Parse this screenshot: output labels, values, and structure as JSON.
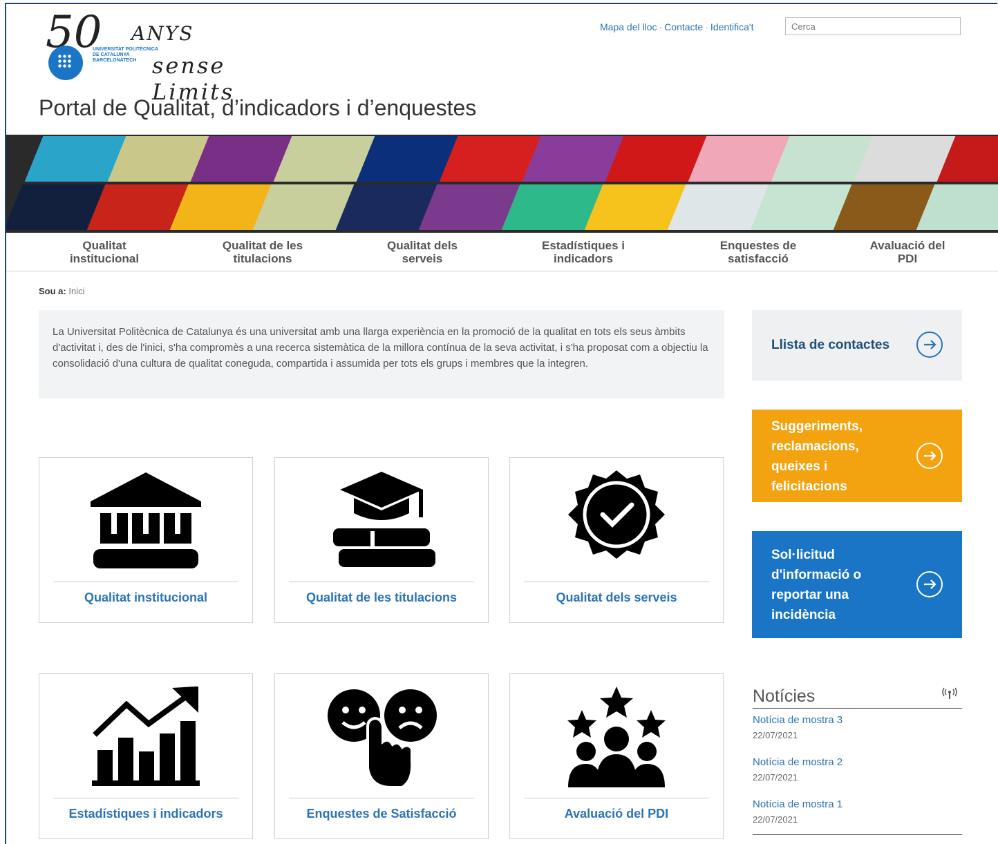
{
  "header": {
    "logo_fifty": "50",
    "logo_anys": "ANYS",
    "logo_university": [
      "UNIVERSITAT POLITÈCNICA",
      "DE CATALUNYA",
      "BARCELONATECH"
    ],
    "logo_slogan": "sense Limits",
    "links": [
      "Mapa del lloc",
      "Contacte",
      "Identifica't"
    ],
    "search_placeholder": "Cerca"
  },
  "site_title": "Portal de Qualitat, d’indicadors i d’enquestes",
  "nav": [
    {
      "line1": "Qualitat",
      "line2": "institucional"
    },
    {
      "line1": "Qualitat de les",
      "line2": "titulacions"
    },
    {
      "line1": "Qualitat dels",
      "line2": "serveis"
    },
    {
      "line1": "Estadístiques i",
      "line2": "indicadors"
    },
    {
      "line1": "Enquestes de",
      "line2": "satisfacció"
    },
    {
      "line1": "Avaluació del",
      "line2": "PDI"
    }
  ],
  "breadcrumb": {
    "prefix": "Sou a:",
    "current": "Inici"
  },
  "intro": "La Universitat Politècnica de Catalunya és una universitat amb una llarga experiència en la promoció de la qualitat en tots els seus àmbits d'activitat i, des de l'inici, s'ha compromès a una recerca sistemàtica de la millora contínua de la seva activitat, i s'ha proposat com a objectiu la consolidació d'una cultura de qualitat coneguda, compartida i assumida per tots els grups i membres que la integren.",
  "cards": [
    {
      "label": "Qualitat institucional",
      "icon": "institution-icon"
    },
    {
      "label": "Qualitat de les titulacions",
      "icon": "graduation-books-icon"
    },
    {
      "label": "Qualitat dels serveis",
      "icon": "quality-badge-icon"
    },
    {
      "label": "Estadístiques i indicadors",
      "icon": "growth-chart-icon"
    },
    {
      "label": "Enquestes de Satisfacció",
      "icon": "satisfaction-faces-icon"
    },
    {
      "label": "Avaluació del PDI",
      "icon": "team-stars-icon"
    }
  ],
  "side": {
    "contacts": "Llista de contactes",
    "suggestions": [
      "Suggeriments,",
      "reclamacions,",
      "queixes i",
      "felicitacions"
    ],
    "request": [
      "Sol·licitud",
      "d'informació o",
      "reportar una",
      "incidència"
    ]
  },
  "news": {
    "title": "Notícies",
    "items": [
      {
        "title": "Notícia de mostra 3",
        "date": "22/07/2021"
      },
      {
        "title": "Notícia de mostra 2",
        "date": "22/07/2021"
      },
      {
        "title": "Notícia de mostra 1",
        "date": "22/07/2021"
      }
    ]
  },
  "colors": {
    "link": "#2b73b3",
    "orange": "#f2a30f",
    "blue": "#1a75c7",
    "box_gray": "#eef0f2"
  }
}
